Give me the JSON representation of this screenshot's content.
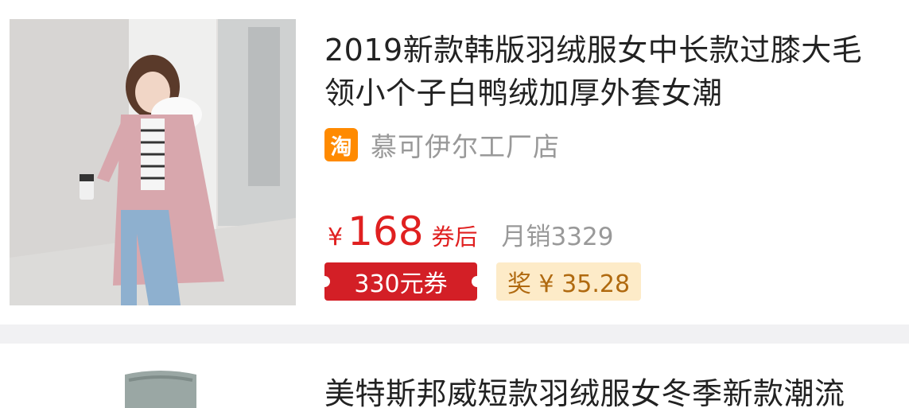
{
  "products": [
    {
      "title": "2019新款韩版羽绒服女中长款过膝大毛领小个子白鸭绒加厚外套女潮",
      "shop_icon": "淘",
      "shop_name": "慕可伊尔工厂店",
      "currency": "¥",
      "price": "168",
      "price_suffix": "券后",
      "sales": "月销3329",
      "coupon": "330元券",
      "reward": "奖 ¥ 35.28"
    },
    {
      "title": "美特斯邦威短款羽绒服女冬季新款潮流"
    }
  ],
  "colors": {
    "price_red": "#e02020",
    "coupon_red": "#d31f26",
    "reward_bg": "#fdebc8",
    "reward_text": "#b06a10",
    "taobao_orange": "#ff8a00"
  }
}
